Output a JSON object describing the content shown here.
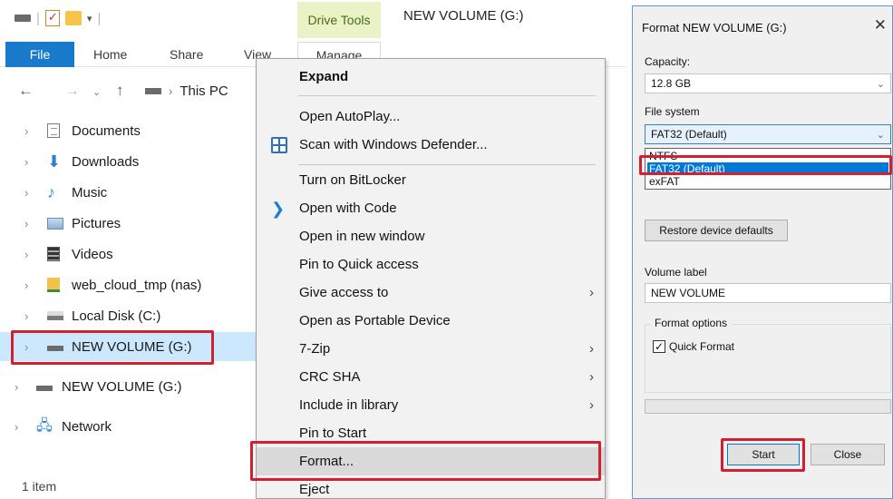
{
  "explorer": {
    "window_title": "NEW VOLUME (G:)",
    "contextual_tab": "Drive Tools",
    "tabs": [
      "File",
      "Home",
      "Share",
      "View",
      "Manage"
    ],
    "breadcrumb": "This PC",
    "nav_items": [
      {
        "label": "Documents",
        "icon": "documents-icon"
      },
      {
        "label": "Downloads",
        "icon": "downloads-icon"
      },
      {
        "label": "Music",
        "icon": "music-icon"
      },
      {
        "label": "Pictures",
        "icon": "pictures-icon"
      },
      {
        "label": "Videos",
        "icon": "videos-icon"
      },
      {
        "label": "web_cloud_tmp (nas)",
        "icon": "network-drive-icon"
      },
      {
        "label": "Local Disk (C:)",
        "icon": "local-disk-icon"
      },
      {
        "label": "NEW VOLUME (G:)",
        "icon": "usb-drive-icon",
        "selected": true
      },
      {
        "label": "NEW VOLUME (G:)",
        "icon": "usb-drive-icon"
      },
      {
        "label": "Network",
        "icon": "network-icon"
      }
    ],
    "status": "1 item"
  },
  "context_menu": {
    "items": [
      {
        "label": "Expand",
        "bold": true
      },
      {
        "label": "Open AutoPlay..."
      },
      {
        "label": "Scan with Windows Defender...",
        "icon": "windows-defender-icon"
      },
      {
        "label": "Turn on BitLocker"
      },
      {
        "label": "Open with Code",
        "icon": "vscode-icon"
      },
      {
        "label": "Open in new window"
      },
      {
        "label": "Pin to Quick access"
      },
      {
        "label": "Give access to",
        "submenu": true
      },
      {
        "label": "Open as Portable Device"
      },
      {
        "label": "7-Zip",
        "submenu": true
      },
      {
        "label": "CRC SHA",
        "submenu": true
      },
      {
        "label": "Include in library",
        "submenu": true
      },
      {
        "label": "Pin to Start"
      },
      {
        "label": "Format...",
        "highlighted": true
      },
      {
        "label": "Eject"
      }
    ]
  },
  "format_dialog": {
    "title": "Format NEW VOLUME (G:)",
    "capacity_label": "Capacity:",
    "capacity_value": "12.8 GB",
    "fs_label": "File system",
    "fs_value": "FAT32 (Default)",
    "fs_options": [
      "NTFS",
      "FAT32 (Default)",
      "exFAT"
    ],
    "fs_selected": "FAT32 (Default)",
    "restore_button": "Restore device defaults",
    "volume_label_label": "Volume label",
    "volume_label_value": "NEW VOLUME",
    "format_options_label": "Format options",
    "quick_format_label": "Quick Format",
    "quick_format_checked": true,
    "start_button": "Start",
    "close_button": "Close"
  },
  "colors": {
    "highlight": "#d41f2f",
    "file_tab": "#1979ca",
    "drive_tools": "#eaf3c5",
    "selection": "#cce8ff",
    "list_select": "#0078d7"
  }
}
